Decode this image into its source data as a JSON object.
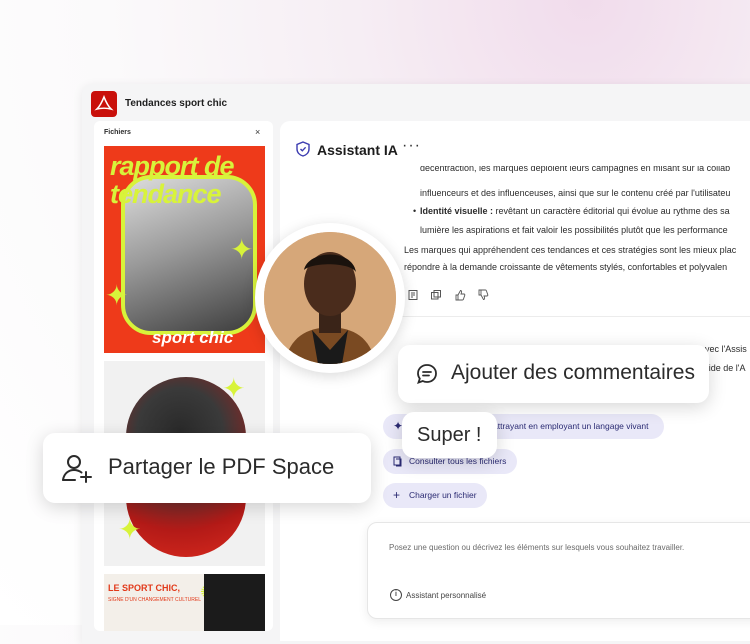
{
  "app": {
    "title": "Tendances sport chic",
    "logo_icon": "acrobat-icon",
    "brand_color": "#c9100b"
  },
  "files_panel": {
    "heading": "Fichiers",
    "close_icon": "close-icon",
    "thumbnails": [
      {
        "title": "rapport de tendance",
        "subtitle": "sport chic"
      },
      {
        "title": "",
        "subtitle": ""
      },
      {
        "title": "LE SPORT CHIC,",
        "subtitle": "SIGNE D'UN CHANGEMENT CULTUREL"
      }
    ]
  },
  "assistant": {
    "title": "Assistant IA",
    "more_icon": "more-icon",
    "message_lines": [
      "décentraction, les marques déploient leurs campagnes en misant sur la collab",
      "influenceurs et des influenceuses, ainsi que sur le contenu créé par l'utilisateu",
      "Identité visuelle : revêtant un caractère éditorial qui évolue au rythme des sa",
      "lumière les aspirations et fait valoir les possibilités plutôt que les performance",
      "Les marques qui appréhendent ces tendances et ces stratégies sont les mieux plac",
      "répondre à la demande croissante de vêtements stylés, confortables et polyvalen"
    ],
    "bullet_bold": "Identité visuelle :",
    "bullet_rest": " revêtant un caractère éditorial qui évolue au rythme des sa",
    "feedback_icons": [
      "summary-icon",
      "copy-icon",
      "thumbs-up-icon",
      "thumbs-down-icon"
    ],
    "partial_lines": [
      "avec l'Assis",
      "l'aide de l'A"
    ],
    "suggestions": [
      {
        "icon": "sparkle-icon",
        "label": "attrayant en employant un langage vivant"
      },
      {
        "icon": "files-icon",
        "label": "Consulter tous les fichiers"
      },
      {
        "icon": "plus-icon",
        "label": "Charger un fichier"
      }
    ],
    "prompt": {
      "placeholder": "Posez une question ou décrivez les éléments sur lesquels vous souhaitez travailler.",
      "footer_label": "Assistant personnalisé",
      "footer_icon": "info-icon"
    }
  },
  "floating": {
    "comments": {
      "label": "Ajouter des commentaires",
      "icon": "comment-icon"
    },
    "reply": {
      "label": "Super !"
    },
    "share": {
      "label": "Partager le PDF Space",
      "icon": "add-user-icon"
    },
    "avatar": {
      "icon": "avatar"
    }
  },
  "colors": {
    "accent_yellow": "#d8f33a",
    "thumb_red": "#ee3a1a",
    "chip_bg": "#e9e8f8"
  }
}
